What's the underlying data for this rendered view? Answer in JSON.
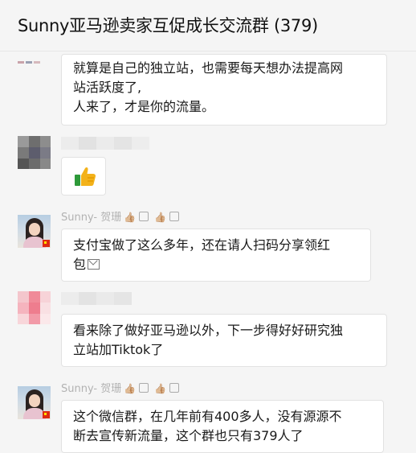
{
  "header": {
    "title": "Sunny亚马逊卖家互促成长交流群 (379)"
  },
  "messages": {
    "m1": {
      "lines": [
        "就算是自己的独立站，也需要每天想办法提高网",
        "站活跃度了,",
        "人来了，才是你的流量。"
      ]
    },
    "m2": {
      "emoji": "thumbs-up"
    },
    "m3": {
      "sender": "Sunny- 贺珊",
      "lines": [
        "支付宝做了这么多年，还在请人扫码分享领红",
        "包"
      ]
    },
    "m4": {
      "lines": [
        "看来除了做好亚马逊以外，下一步得好好研究独",
        "立站加Tiktok了"
      ]
    },
    "m5": {
      "sender": "Sunny- 贺珊",
      "lines": [
        "这个微信群，在几年前有400多人，没有源源不",
        "断去宣传新流量，这个群也只有379人了"
      ]
    }
  },
  "icons": {
    "reaction": "👍🏼",
    "checkbox": "square-icon",
    "red-packet": "envelope-icon"
  },
  "colors": {
    "background": "#f5f5f5",
    "bubble": "#ffffff",
    "name": "#b2b2b2"
  }
}
